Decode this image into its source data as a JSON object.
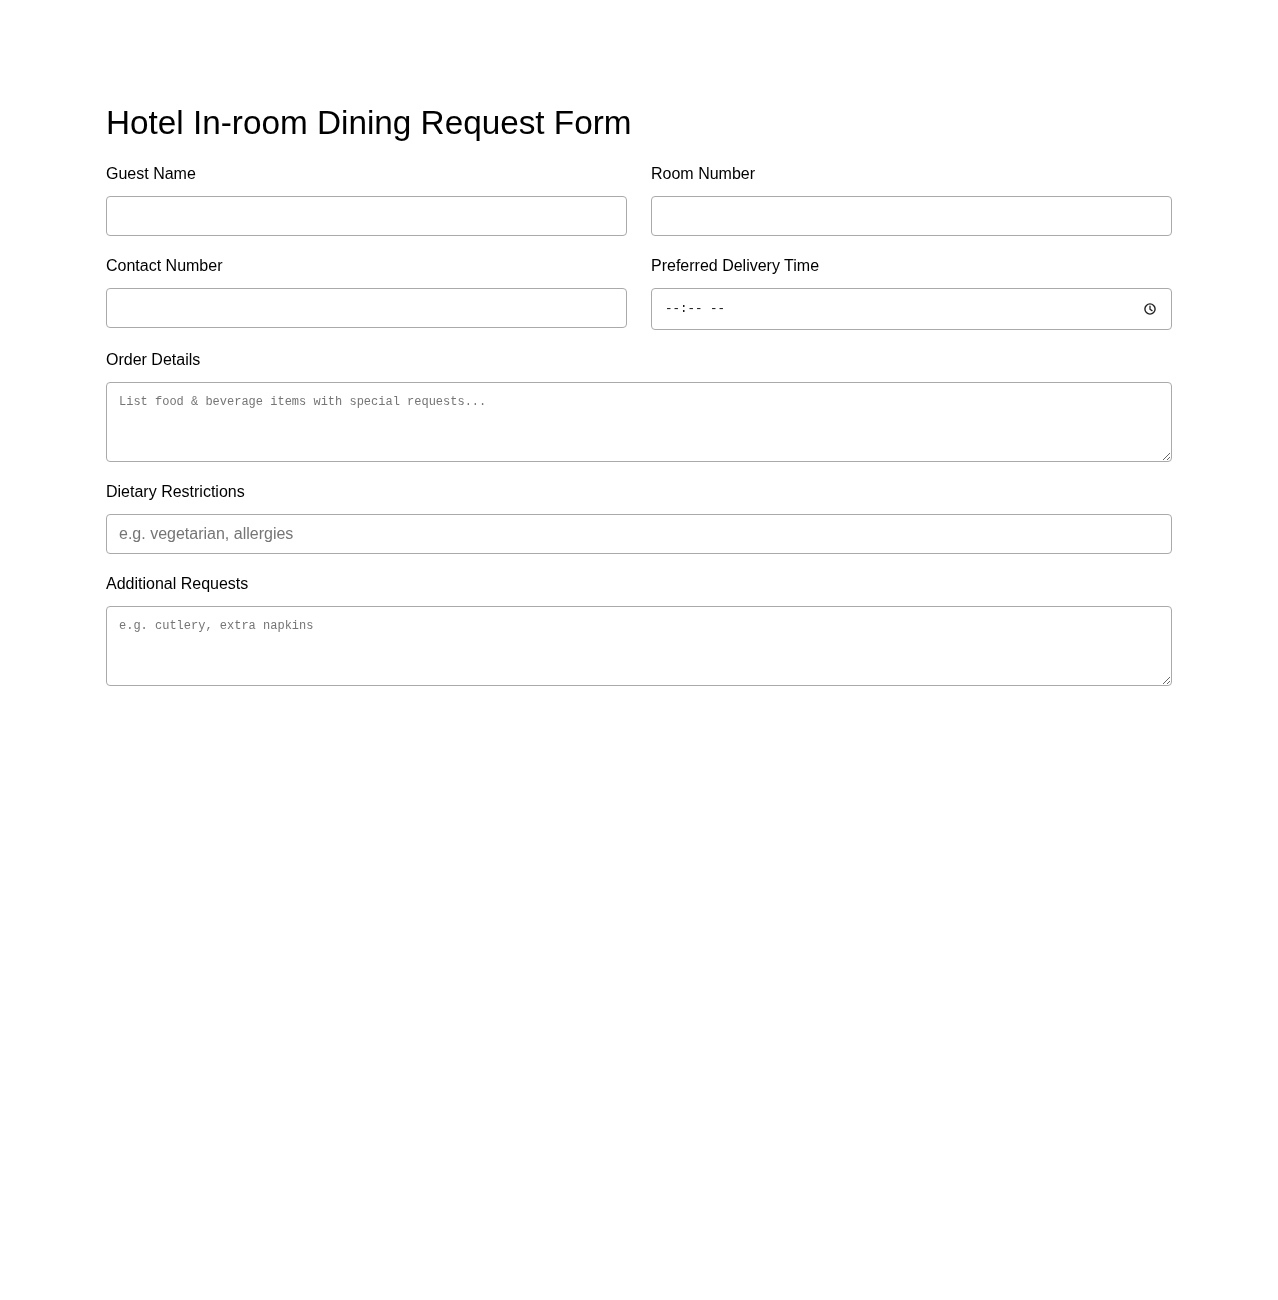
{
  "title": "Hotel In-room Dining Request Form",
  "rows": [
    [
      {
        "kind": "text",
        "label": "Guest Name"
      },
      {
        "kind": "text",
        "label": "Room Number"
      }
    ],
    [
      {
        "kind": "text",
        "label": "Contact Number"
      },
      {
        "kind": "time",
        "label": "Preferred Delivery Time",
        "placeholder": "--:-- --"
      }
    ],
    [
      {
        "kind": "textarea",
        "label": "Order Details",
        "placeholder": "List food & beverage items with special requests..."
      }
    ],
    [
      {
        "kind": "text",
        "label": "Dietary Restrictions",
        "placeholder": "e.g. vegetarian, allergies"
      }
    ],
    [
      {
        "kind": "textarea",
        "label": "Additional Requests",
        "placeholder": "e.g. cutlery, extra napkins"
      }
    ]
  ]
}
